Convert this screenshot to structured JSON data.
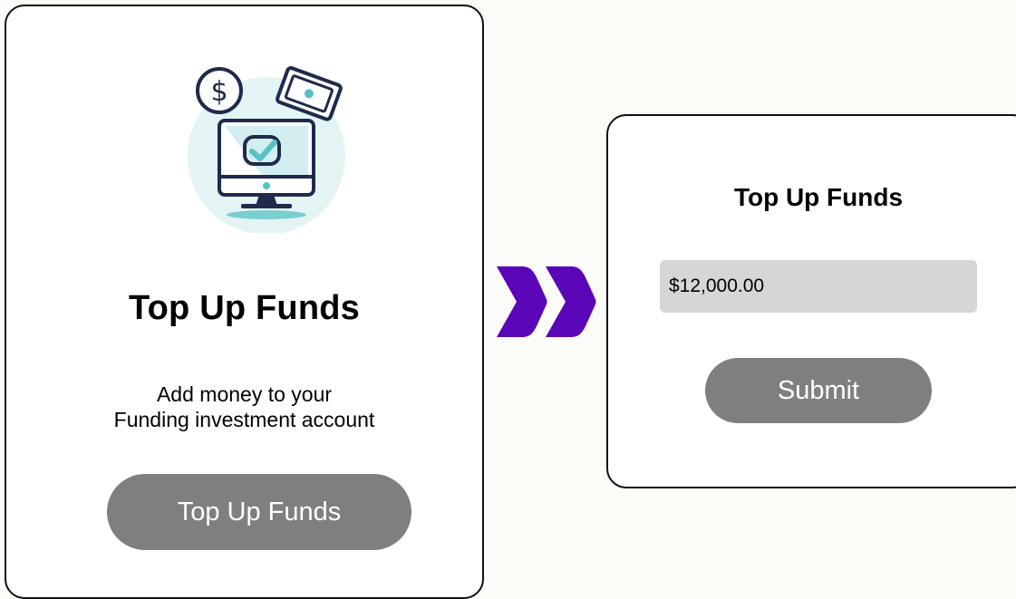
{
  "colors": {
    "background": "#fbfbf7",
    "card": "#ffffff",
    "button": "#7f7f81",
    "input": "#d5d6d6",
    "arrow": "#5a06b8",
    "illustration_teal": "#56c1c4",
    "illustration_navy": "#1f2a4c",
    "illustration_circle": "#e4f3f4"
  },
  "left_card": {
    "icon": "monitor-money-check-illustration",
    "title": "Top Up Funds",
    "description_lines": [
      "Add money to your",
      "Funding investment account"
    ],
    "button_label": "Top Up Funds"
  },
  "connector": {
    "icon": "double-chevron-right-icon"
  },
  "right_card": {
    "title": "Top Up Funds",
    "amount_value": "$12,000.00",
    "submit_label": "Submit"
  }
}
